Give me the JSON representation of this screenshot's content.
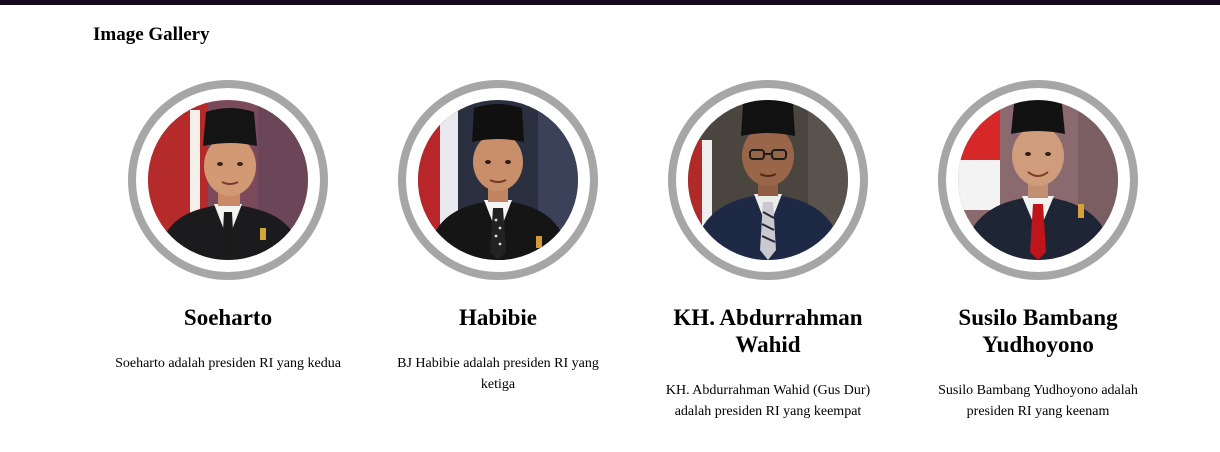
{
  "gallery": {
    "heading": "Image Gallery",
    "items": [
      {
        "name": "Soeharto",
        "description": "Soeharto adalah presiden RI yang kedua",
        "image_alt": "Portrait of Soeharto"
      },
      {
        "name": "Habibie",
        "description": "BJ Habibie adalah presiden RI yang ketiga",
        "image_alt": "Portrait of Habibie"
      },
      {
        "name": "KH. Abdurrahman Wahid",
        "description": "KH. Abdurrahman Wahid (Gus Dur) adalah presiden RI yang keempat",
        "image_alt": "Portrait of KH. Abdurrahman Wahid"
      },
      {
        "name": "Susilo Bambang Yudhoyono",
        "description": "Susilo Bambang Yudhoyono adalah presiden RI yang keenam",
        "image_alt": "Portrait of Susilo Bambang Yudhoyono"
      }
    ]
  },
  "colors": {
    "top_bar": "#140a1a",
    "ring": "#a6a6a6"
  }
}
